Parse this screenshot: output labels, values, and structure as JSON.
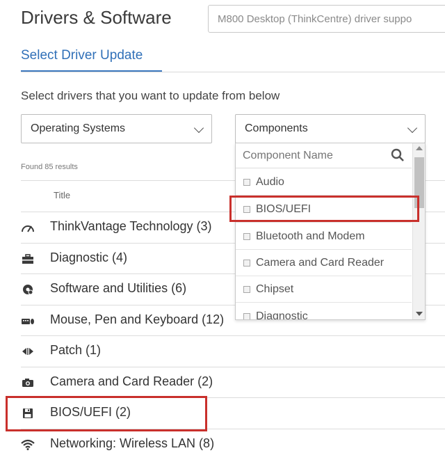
{
  "header": {
    "title": "Drivers & Software",
    "search_value": "M800 Desktop (ThinkCentre) driver suppo"
  },
  "tabs": {
    "active_label": "Select Driver Update"
  },
  "instruction": "Select drivers that you want to update from below",
  "filters": {
    "os_select": "Operating Systems",
    "components_select": "Components"
  },
  "results": {
    "count_text": "Found 85 results",
    "column_title": "Title",
    "rows": [
      {
        "label": "ThinkVantage Technology (3)",
        "icon": "gauge-icon"
      },
      {
        "label": "Diagnostic (4)",
        "icon": "toolbox-icon"
      },
      {
        "label": "Software and Utilities (6)",
        "icon": "software-gear-icon"
      },
      {
        "label": "Mouse, Pen and Keyboard (12)",
        "icon": "keyboard-mouse-icon"
      },
      {
        "label": "Patch (1)",
        "icon": "patch-arrows-icon"
      },
      {
        "label": "Camera and Card Reader (2)",
        "icon": "camera-icon"
      },
      {
        "label": "BIOS/UEFI (2)",
        "icon": "floppy-disk-icon"
      },
      {
        "label": "Networking: Wireless LAN (8)",
        "icon": "wifi-icon"
      }
    ]
  },
  "components_dropdown": {
    "search_placeholder": "Component Name",
    "items": [
      "Audio",
      "BIOS/UEFI",
      "Bluetooth and Modem",
      "Camera and Card Reader",
      "Chipset",
      "Diagnostic"
    ]
  },
  "colors": {
    "accent": "#3d79bf",
    "highlight": "#c9302c"
  }
}
